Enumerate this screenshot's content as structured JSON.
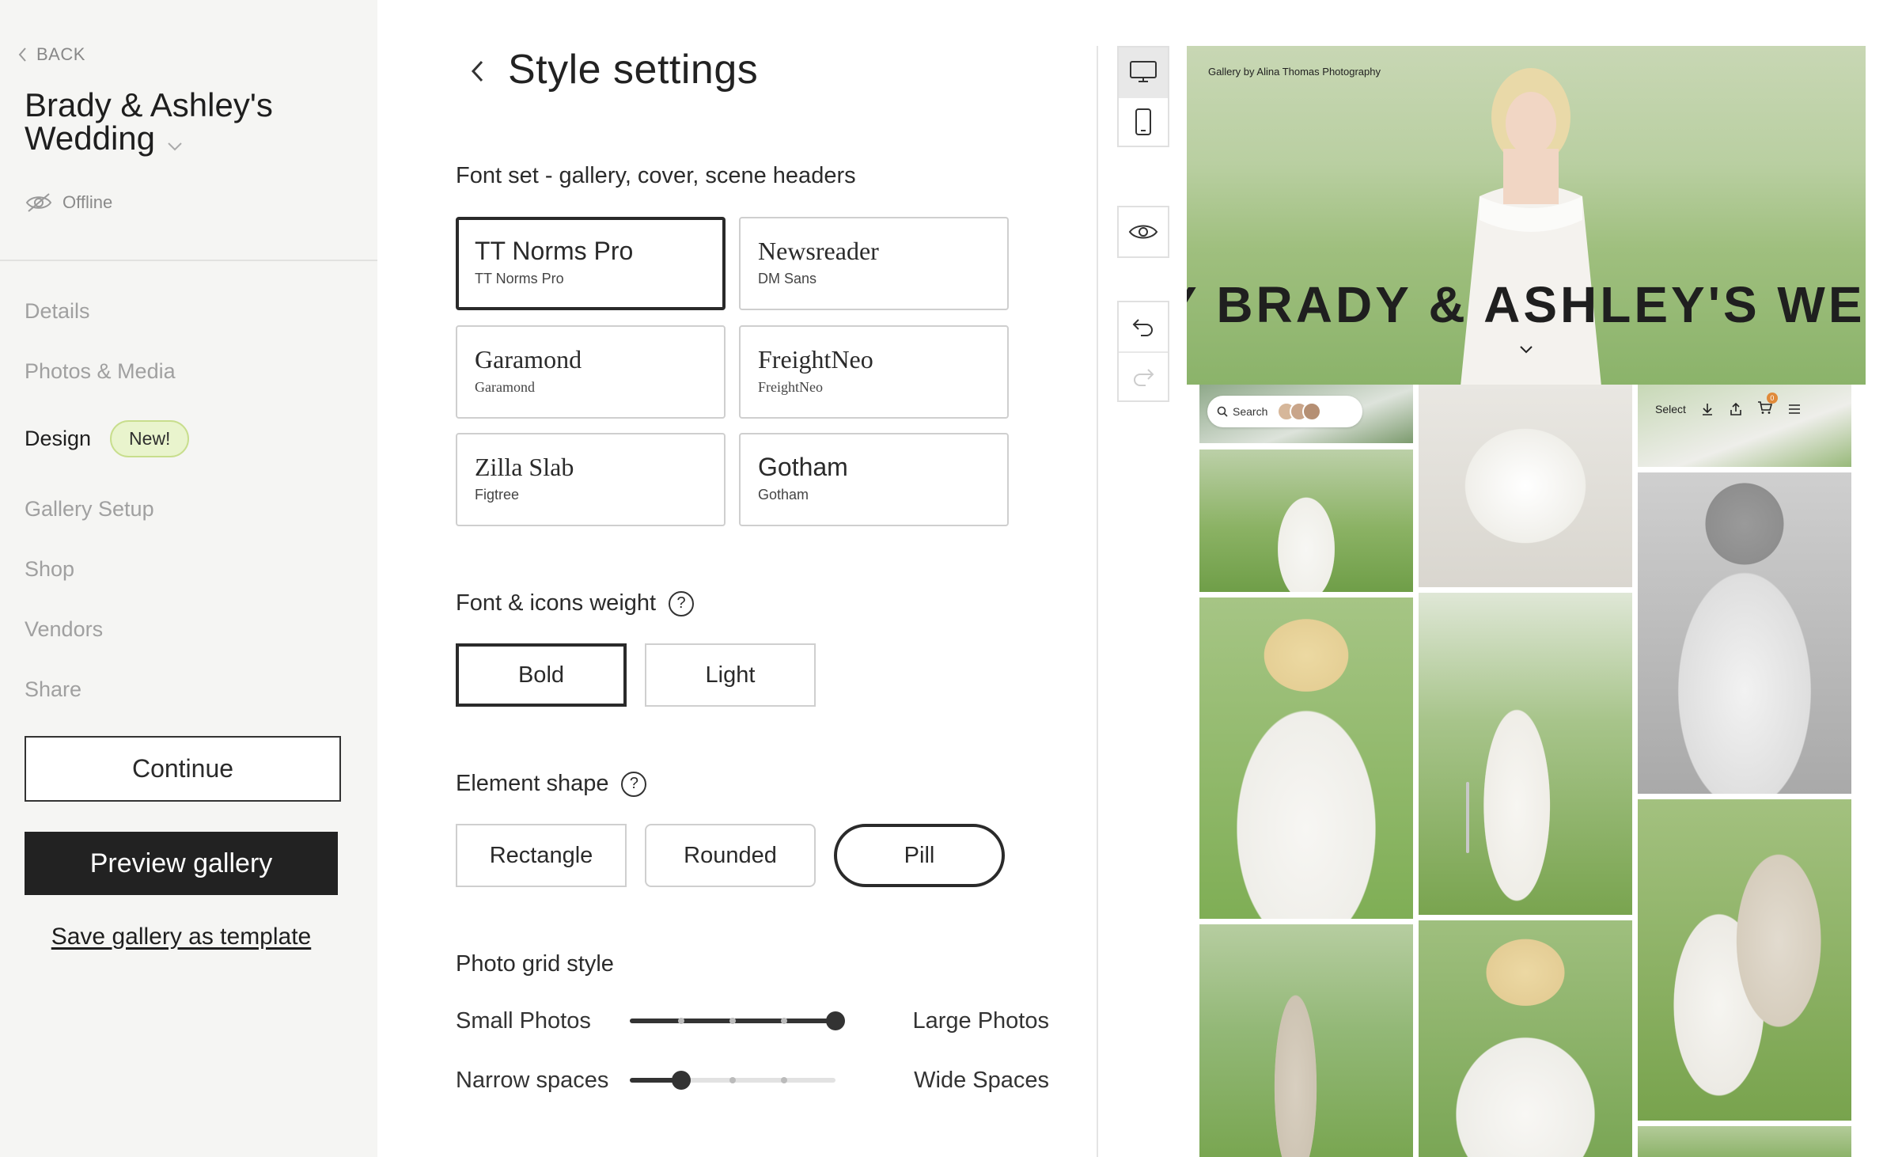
{
  "sidebar": {
    "back_label": "BACK",
    "gallery_title": "Brady & Ashley's Wedding",
    "status": "Offline",
    "nav": [
      {
        "label": "Details",
        "active": false
      },
      {
        "label": "Photos & Media",
        "active": false
      },
      {
        "label": "Design",
        "active": true,
        "badge": "New!"
      },
      {
        "label": "Gallery Setup",
        "active": false
      },
      {
        "label": "Shop",
        "active": false
      },
      {
        "label": "Vendors",
        "active": false
      },
      {
        "label": "Share",
        "active": false
      }
    ],
    "continue_label": "Continue",
    "preview_label": "Preview gallery",
    "template_link": "Save gallery as template"
  },
  "settings": {
    "title": "Style settings",
    "font_set": {
      "label": "Font set - gallery, cover, scene headers",
      "options": [
        {
          "name": "TT Norms Pro",
          "sub": "TT Norms Pro",
          "selected": true
        },
        {
          "name": "Newsreader",
          "sub": "DM Sans",
          "selected": false
        },
        {
          "name": "Garamond",
          "sub": "Garamond",
          "selected": false
        },
        {
          "name": "FreightNeo",
          "sub": "FreightNeo",
          "selected": false
        },
        {
          "name": "Zilla Slab",
          "sub": "Figtree",
          "selected": false
        },
        {
          "name": "Gotham",
          "sub": "Gotham",
          "selected": false
        }
      ]
    },
    "weight": {
      "label": "Font & icons weight",
      "help": "?",
      "options": [
        {
          "label": "Bold",
          "selected": true
        },
        {
          "label": "Light",
          "selected": false
        }
      ]
    },
    "shape": {
      "label": "Element shape",
      "help": "?",
      "options": [
        {
          "label": "Rectangle",
          "selected": false
        },
        {
          "label": "Rounded",
          "selected": false
        },
        {
          "label": "Pill",
          "selected": true
        }
      ]
    },
    "grid": {
      "label": "Photo grid style",
      "size": {
        "left": "Small Photos",
        "right": "Large Photos",
        "value": 1.0
      },
      "spacing": {
        "left": "Narrow spaces",
        "right": "Wide Spaces",
        "value": 0.25
      }
    }
  },
  "toolbar": {
    "device_icons": [
      "desktop-icon",
      "mobile-icon"
    ],
    "preview_icon": "eye-icon",
    "history_icons": [
      "undo-icon",
      "redo-icon"
    ]
  },
  "preview": {
    "credit": "Gallery by Alina Thomas Photography",
    "hero_title": "Y BRADY & ASHLEY'S WEDDIN",
    "search_placeholder": "Search",
    "select_label": "Select",
    "cart_count": "0"
  },
  "colors": {
    "sidebar_bg": "#f5f5f3",
    "primary_dark": "#222222",
    "badge_bg": "#e9f4cd",
    "badge_border": "#c8de8d"
  }
}
